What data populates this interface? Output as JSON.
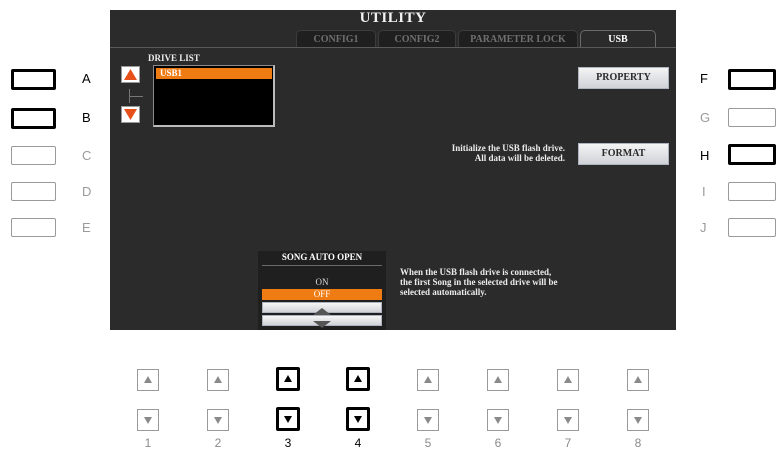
{
  "screen": {
    "title": "UTILITY",
    "tabs": [
      {
        "label": "CONFIG1",
        "active": false
      },
      {
        "label": "CONFIG2",
        "active": false
      },
      {
        "label": "PARAMETER LOCK",
        "active": false
      },
      {
        "label": "USB",
        "active": true
      }
    ],
    "drive_list": {
      "label": "DRIVE LIST",
      "items": [
        "USB1"
      ],
      "selected": "USB1"
    },
    "property_button": "PROPERTY",
    "format_text_line1": "Initialize the USB flash drive.",
    "format_text_line2": "All data will be deleted.",
    "format_button": "FORMAT",
    "song_auto_open": {
      "title": "SONG AUTO OPEN",
      "options": [
        "ON",
        "OFF"
      ],
      "selected": "OFF"
    },
    "song_auto_open_desc": [
      "When the USB flash drive is connected,",
      "the first Song in the selected drive will be",
      "selected automatically."
    ]
  },
  "left_buttons": [
    {
      "letter": "A",
      "active": true
    },
    {
      "letter": "B",
      "active": true
    },
    {
      "letter": "C",
      "active": false
    },
    {
      "letter": "D",
      "active": false
    },
    {
      "letter": "E",
      "active": false
    }
  ],
  "right_buttons": [
    {
      "letter": "F",
      "active": true
    },
    {
      "letter": "G",
      "active": false
    },
    {
      "letter": "H",
      "active": true
    },
    {
      "letter": "I",
      "active": false
    },
    {
      "letter": "J",
      "active": false
    }
  ],
  "bottom_buttons": [
    {
      "number": "1",
      "active": false
    },
    {
      "number": "2",
      "active": false
    },
    {
      "number": "3",
      "active": true
    },
    {
      "number": "4",
      "active": true
    },
    {
      "number": "5",
      "active": false
    },
    {
      "number": "6",
      "active": false
    },
    {
      "number": "7",
      "active": false
    },
    {
      "number": "8",
      "active": false
    }
  ],
  "colors": {
    "selection": "#ef7b13",
    "screen_bg": "#2b2b2b",
    "arrow": "#e8501a"
  }
}
